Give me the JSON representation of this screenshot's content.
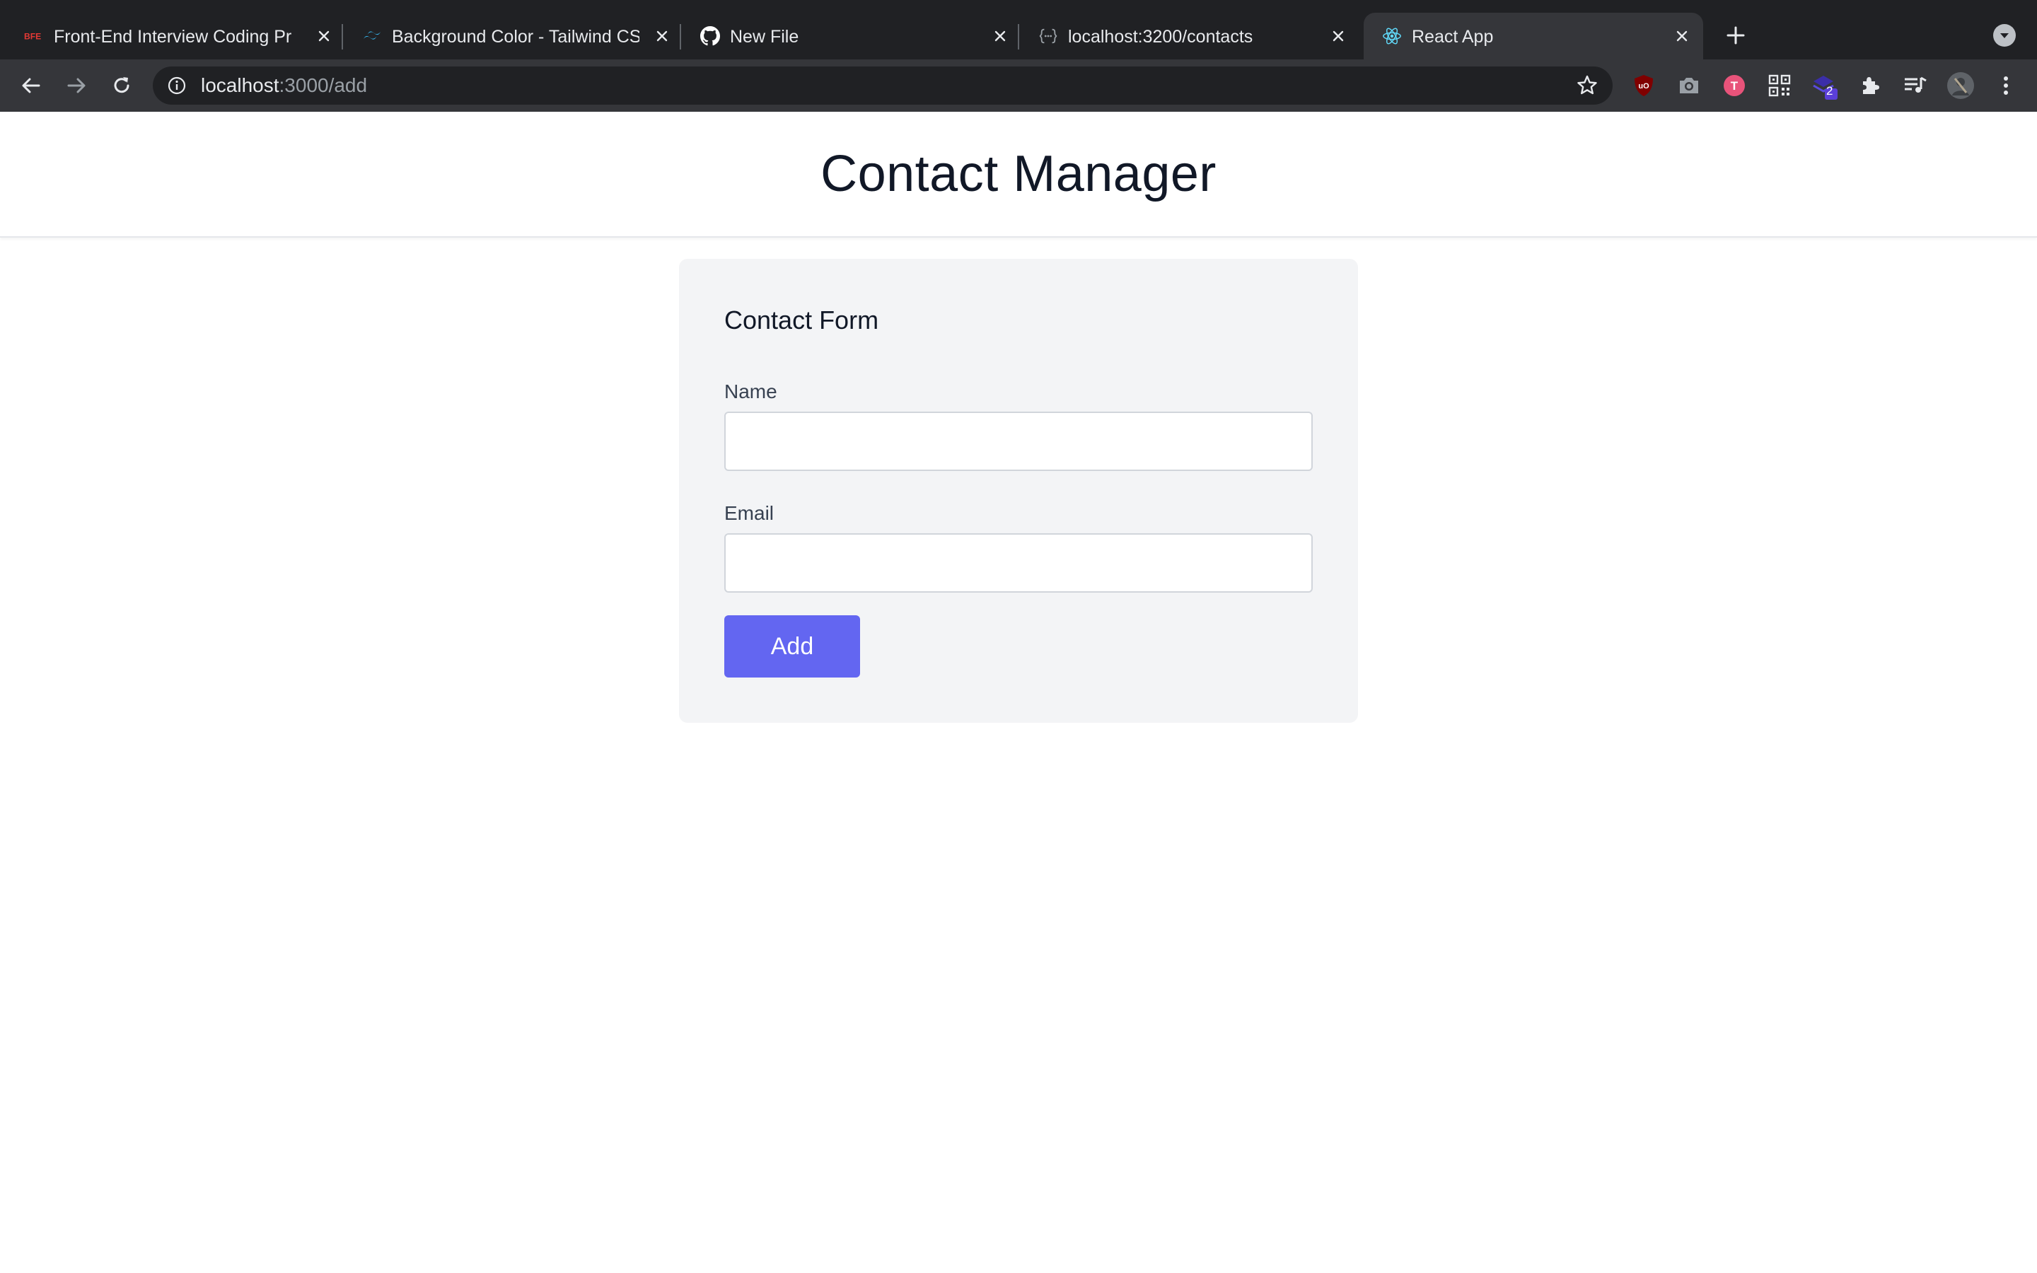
{
  "browser": {
    "tabs": [
      {
        "title": "Front-End Interview Coding Pr",
        "favicon": "bfe-logo-icon",
        "active": false
      },
      {
        "title": "Background Color - Tailwind CS",
        "favicon": "tailwind-logo-icon",
        "active": false
      },
      {
        "title": "New File",
        "favicon": "github-logo-icon",
        "active": false
      },
      {
        "title": "localhost:3200/contacts",
        "favicon": "json-bracket-icon",
        "active": false
      },
      {
        "title": "React App",
        "favicon": "react-logo-icon",
        "active": true
      }
    ],
    "address": {
      "host": "localhost",
      "path": ":3000/add"
    },
    "extensions": [
      "ublock-icon",
      "camera-icon",
      "t-badge-icon",
      "qr-code-icon",
      "stack-badge-icon",
      "puzzle-icon",
      "media-queue-icon",
      "profile-avatar-icon",
      "more-menu-icon"
    ],
    "extension_badge_count": "2"
  },
  "page": {
    "title": "Contact Manager",
    "form": {
      "heading": "Contact Form",
      "name_label": "Name",
      "name_value": "",
      "email_label": "Email",
      "email_value": "",
      "submit_label": "Add"
    }
  },
  "colors": {
    "tabstrip": "#202124",
    "toolbar": "#35363a",
    "card": "#f3f4f6",
    "button": "#6366f1",
    "heading": "#111827"
  }
}
